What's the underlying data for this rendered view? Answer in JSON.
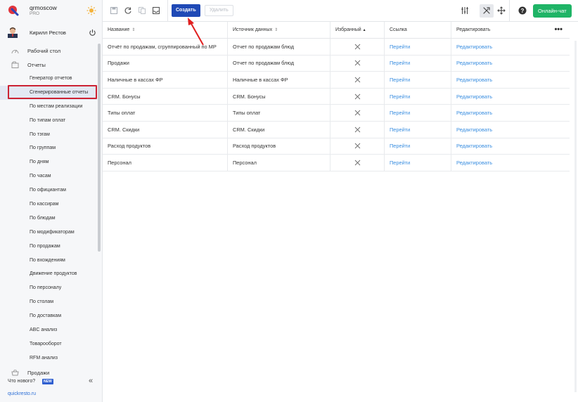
{
  "brand": {
    "name": "qrmoscow",
    "plan": "PRO"
  },
  "user": {
    "name": "Кирилл Рестов"
  },
  "nav_top": [
    {
      "label": "Рабочий стол",
      "icon": "dashboard-icon"
    },
    {
      "label": "Отчеты",
      "icon": "reports-icon"
    }
  ],
  "submenu": [
    "Генератор отчетов",
    "Сгенерированные отчеты",
    "По местам реализации",
    "По типам оплат",
    "По тэгам",
    "По группам",
    "По дням",
    "По часам",
    "По официантам",
    "По кассирам",
    "По блюдам",
    "По модификаторам",
    "По продажам",
    "По вхождениям",
    "Движение продуктов",
    "По персоналу",
    "По столам",
    "По доставкам",
    "ABC анализ",
    "Товарооборот",
    "RFM анализ"
  ],
  "active_submenu_index": 1,
  "nav_bottom": {
    "label": "Продажи",
    "icon": "basket-icon"
  },
  "footer": {
    "whats_new": "Что нового?",
    "badge": "NEW",
    "site": "quickresto.ru"
  },
  "toolbar": {
    "create_label": "Создать",
    "delete_label": "Удалить",
    "chat_label": "Онлайн-чат",
    "icons": [
      "save-icon",
      "refresh-icon",
      "copy-icon",
      "archive-icon",
      "sliders-icon",
      "tools-icon",
      "move-icon",
      "help-icon"
    ]
  },
  "table": {
    "headers": {
      "name": "Название",
      "source": "Источник данных",
      "favorite": "Избранный",
      "link": "Ссылка",
      "edit": "Редактировать"
    },
    "rows": [
      {
        "name": "Отчёт по продажам, сгруппированный по МР",
        "source": "Отчет по продажам блюд",
        "link": "Перейти",
        "edit": "Редактировать"
      },
      {
        "name": "Продажи",
        "source": "Отчет по продажам блюд",
        "link": "Перейти",
        "edit": "Редактировать"
      },
      {
        "name": "Наличные в кассах ФР",
        "source": "Наличные в кассах ФР",
        "link": "Перейти",
        "edit": "Редактировать"
      },
      {
        "name": "CRM. Бонусы",
        "source": "CRM. Бонусы",
        "link": "Перейти",
        "edit": "Редактировать"
      },
      {
        "name": "Типы оплат",
        "source": "Типы оплат",
        "link": "Перейти",
        "edit": "Редактировать"
      },
      {
        "name": "CRM. Скидки",
        "source": "CRM. Скидки",
        "link": "Перейти",
        "edit": "Редактировать"
      },
      {
        "name": "Расход продуктов",
        "source": "Расход продуктов",
        "link": "Перейти",
        "edit": "Редактировать"
      },
      {
        "name": "Персонал",
        "source": "Персонал",
        "link": "Перейти",
        "edit": "Редактировать"
      }
    ]
  },
  "colors": {
    "primary": "#1f49b6",
    "chat": "#1fb466",
    "link": "#3a8ee0",
    "highlight": "#cc2233"
  }
}
